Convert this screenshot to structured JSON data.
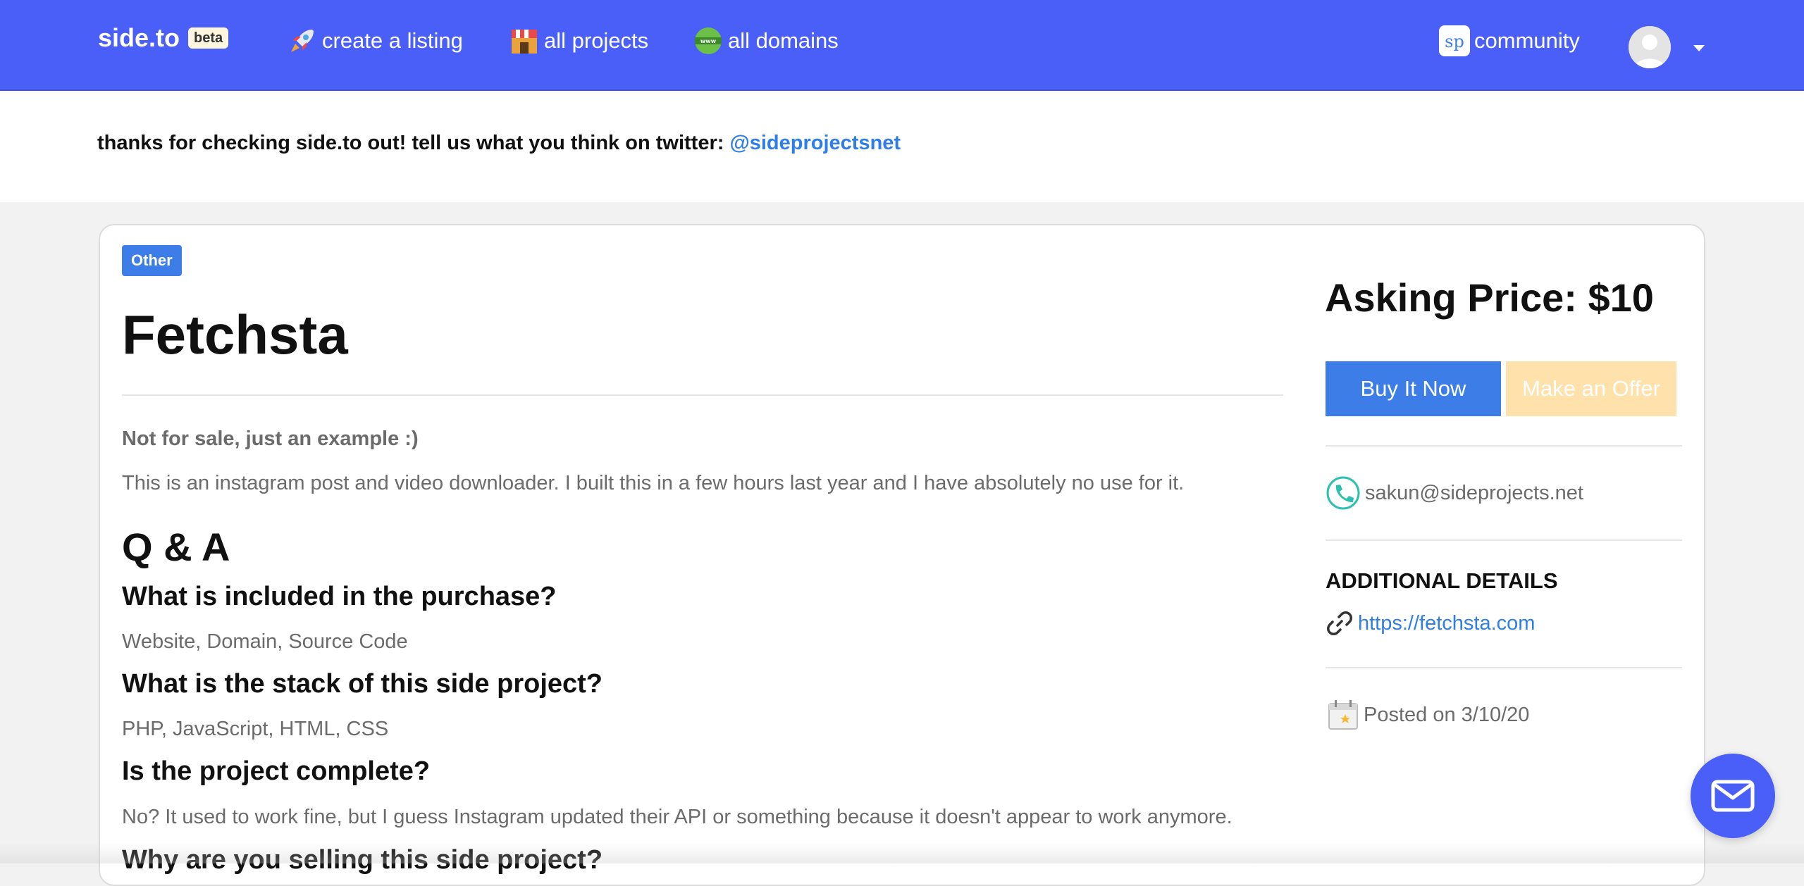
{
  "navbar": {
    "brand": "side.to",
    "beta": "beta",
    "links": {
      "create": "create a listing",
      "projects": "all projects",
      "domains": "all domains",
      "community": "community"
    },
    "icons": {
      "create": "rocket-icon",
      "projects": "store-icon",
      "domains": "globe-www-icon",
      "community": "sideprojects-logo-icon",
      "avatar": "user-avatar",
      "menu": "caret-down-icon"
    },
    "color": "#4a5ff7"
  },
  "announcement": {
    "text": "thanks for checking side.to out! tell us what you think on twitter:",
    "handle": "@sideprojectsnet"
  },
  "listing": {
    "category": "Other",
    "title": "Fetchsta",
    "subtitle": "Not for sale, just an example :)",
    "description": "This is an instagram post and video downloader. I built this in a few hours last year and I have absolutely no use for it.",
    "qa_heading": "Q & A",
    "qa": [
      {
        "q": "What is included in the purchase?",
        "a": "Website, Domain, Source Code"
      },
      {
        "q": "What is the stack of this side project?",
        "a": "PHP, JavaScript, HTML, CSS"
      },
      {
        "q": "Is the project complete?",
        "a": "No? It used to work fine, but I guess Instagram updated their API or something because it doesn't appear to work anymore."
      },
      {
        "q": "Why are you selling this side project?",
        "a": ""
      }
    ]
  },
  "sidebar": {
    "price": "Asking Price: $10",
    "buy_label": "Buy It Now",
    "offer_label": "Make an Offer",
    "contact_email": "sakun@sideprojects.net",
    "details_heading": "ADDITIONAL DETAILS",
    "website": "https://fetchsta.com",
    "posted": "Posted on 3/10/20",
    "colors": {
      "buy": "#3d7de8",
      "offer": "#ffe2ab"
    }
  },
  "fab": {
    "icon": "mail-icon"
  }
}
